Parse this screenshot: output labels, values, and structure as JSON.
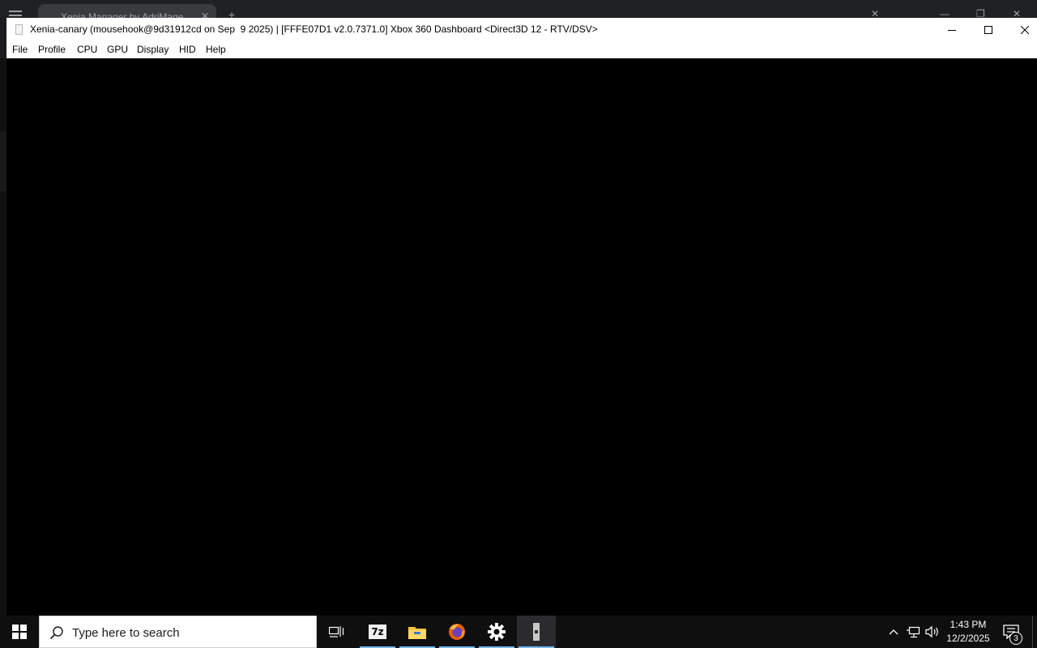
{
  "background_browser": {
    "tab_title": "Xenia Manager by AdriMage"
  },
  "window": {
    "title": "Xenia-canary (mousehook@9d31912cd on Sep  9 2025) | [FFFE07D1 v2.0.7371.0] Xbox 360 Dashboard <Direct3D 12 - RTV/DSV>",
    "minimize_icon": "minimize-icon",
    "maximize_icon": "maximize-icon",
    "close_icon": "close-icon"
  },
  "menubar": {
    "items": [
      {
        "label": "File"
      },
      {
        "label": "Profile"
      },
      {
        "label": "CPU"
      },
      {
        "label": "GPU"
      },
      {
        "label": "Display"
      },
      {
        "label": "HID"
      },
      {
        "label": "Help"
      }
    ]
  },
  "taskbar": {
    "search_placeholder": "Type here to search",
    "apps": [
      {
        "name": "task-view-icon"
      },
      {
        "name": "7zip-icon",
        "label": "7z"
      },
      {
        "name": "file-explorer-icon"
      },
      {
        "name": "firefox-icon"
      },
      {
        "name": "settings-gear-icon"
      },
      {
        "name": "xenia-icon"
      }
    ],
    "clock": {
      "time": "1:43 PM",
      "date": "12/2/2025"
    },
    "notification_count": "3",
    "accent": "#76b9ed"
  }
}
